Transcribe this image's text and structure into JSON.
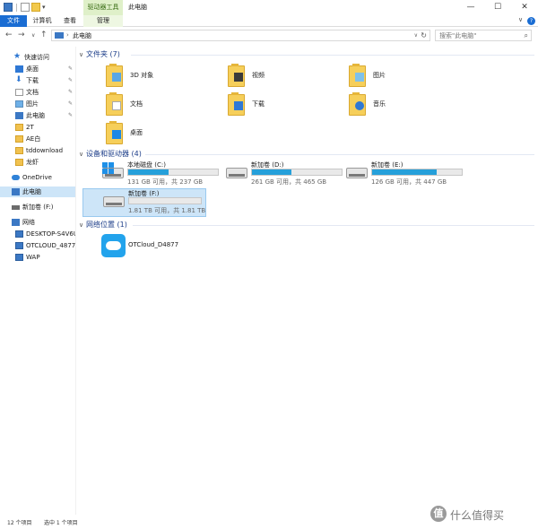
{
  "window": {
    "title": "此电脑",
    "context_tab_group": "驱动器工具",
    "minimize": "—",
    "maximize": "☐",
    "close": "✕"
  },
  "ribbon": {
    "tabs": [
      "文件",
      "计算机",
      "查看",
      "管理"
    ],
    "collapse_glyph": "∨",
    "help_glyph": "?"
  },
  "address": {
    "back": "←",
    "forward": "→",
    "recent": "∨",
    "up": "↑",
    "chevron": "›",
    "path": "此电脑",
    "dropdown": "∨",
    "refresh": "↻"
  },
  "search": {
    "placeholder": "搜索\"此电脑\"",
    "icon": "⌕"
  },
  "sidebar": {
    "items": [
      {
        "label": "快速访问",
        "icon": "star-icon",
        "pinned": false
      },
      {
        "label": "桌面",
        "icon": "desktop-icon",
        "pinned": true
      },
      {
        "label": "下载",
        "icon": "download-icon",
        "pinned": true
      },
      {
        "label": "文档",
        "icon": "document-icon",
        "pinned": true
      },
      {
        "label": "图片",
        "icon": "picture-icon",
        "pinned": true
      },
      {
        "label": "此电脑",
        "icon": "computer-icon",
        "pinned": true
      },
      {
        "label": "2T",
        "icon": "folder-icon",
        "pinned": false
      },
      {
        "label": "AE白",
        "icon": "folder-icon",
        "pinned": false
      },
      {
        "label": "tddownload",
        "icon": "folder-icon",
        "pinned": false
      },
      {
        "label": "龙虾",
        "icon": "folder-icon",
        "pinned": false
      },
      {
        "label": "OneDrive",
        "icon": "cloud-icon",
        "pinned": false
      },
      {
        "label": "此电脑",
        "icon": "computer-icon",
        "pinned": false
      },
      {
        "label": "新加卷 (F:)",
        "icon": "drive-icon",
        "pinned": false
      },
      {
        "label": "网络",
        "icon": "network-icon",
        "pinned": false
      },
      {
        "label": "DESKTOP-S4V6UC",
        "icon": "monitor-icon",
        "pinned": false
      },
      {
        "label": "OTCLOUD_4877",
        "icon": "monitor-icon",
        "pinned": false
      },
      {
        "label": "WAP",
        "icon": "monitor-icon",
        "pinned": false
      }
    ],
    "pin_glyph": "✎"
  },
  "sections": {
    "folders_header": "文件夹 (7)",
    "drives_header": "设备和驱动器 (4)",
    "network_header": "网络位置 (1)",
    "chevron": "∨"
  },
  "folders": [
    {
      "label": "3D 对象",
      "icon": "3d-objects-icon"
    },
    {
      "label": "视频",
      "icon": "video-icon"
    },
    {
      "label": "图片",
      "icon": "picture-icon"
    },
    {
      "label": "文档",
      "icon": "document-icon"
    },
    {
      "label": "下载",
      "icon": "download-icon"
    },
    {
      "label": "音乐",
      "icon": "music-icon"
    },
    {
      "label": "桌面",
      "icon": "desktop-icon"
    }
  ],
  "drives": [
    {
      "name": "本地磁盘 (C:)",
      "free": "131 GB 可用，共 237 GB",
      "used_fraction": 0.45,
      "bar_color": "#26a0da",
      "icon": "windows-icon"
    },
    {
      "name": "新加卷 (D:)",
      "free": "261 GB 可用，共 465 GB",
      "used_fraction": 0.44,
      "bar_color": "#26a0da",
      "icon": "drive-icon"
    },
    {
      "name": "新加卷 (E:)",
      "free": "126 GB 可用，共 447 GB",
      "used_fraction": 0.72,
      "bar_color": "#26a0da",
      "icon": "drive-icon"
    },
    {
      "name": "新加卷 (F:)",
      "free": "1.81 TB 可用，共 1.81 TB",
      "used_fraction": 0.0,
      "bar_color": "#26a0da",
      "icon": "drive-icon"
    }
  ],
  "network": {
    "label": "OTCloud_D4877",
    "icon": "cloud-service-icon"
  },
  "status": {
    "count": "12 个项目",
    "selected": "选中 1 个项目"
  },
  "watermark": {
    "glyph": "值",
    "text": "什么值得买"
  }
}
